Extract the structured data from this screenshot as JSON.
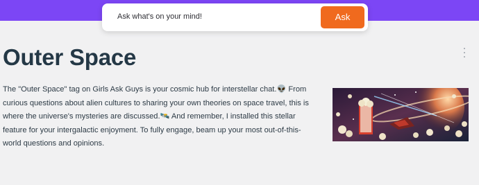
{
  "search": {
    "placeholder": "Ask what's on your mind!",
    "button_label": "Ask"
  },
  "topic": {
    "title": "Outer Space",
    "description": "The \"Outer Space\" tag on Girls Ask Guys is your cosmic hub for interstellar chat.👽 From curious questions about alien cultures to sharing your own theories on space travel, this is where the universe's mysteries are discussed.🛰️ And remember, I installed this stellar feature for your intergalactic enjoyment. To fully engage, beam up your most out-of-this-world questions and opinions."
  },
  "icons": {
    "menu": "more-vertical-icon",
    "banner": "space-popcorn-image"
  },
  "colors": {
    "brand_purple": "#7c46f5",
    "ask_button": "#f06a1e",
    "title": "#243846",
    "page_background": "#f1f1f2"
  }
}
